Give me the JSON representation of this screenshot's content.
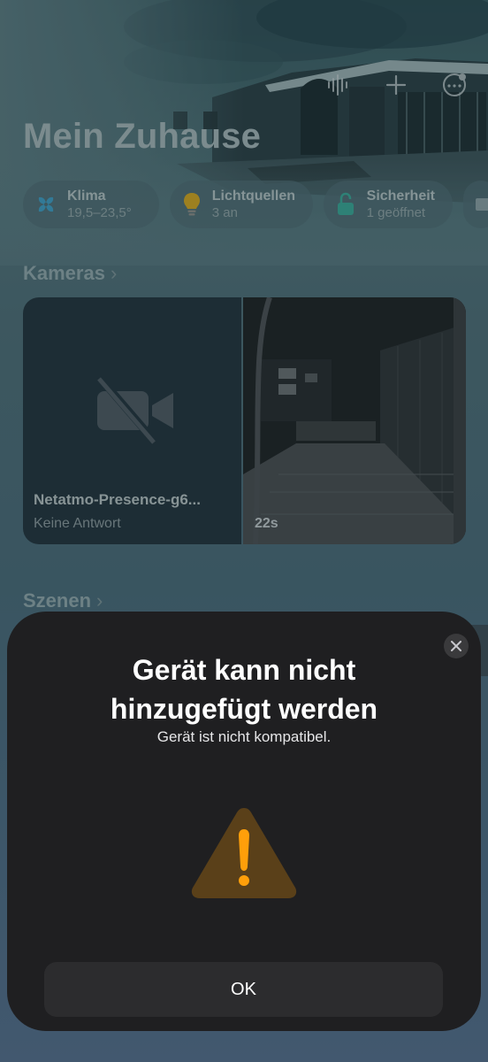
{
  "header": {
    "title": "Mein Zuhause",
    "icons": [
      "waveform-icon",
      "plus-icon",
      "more-icon"
    ]
  },
  "chips": [
    {
      "label": "Klima",
      "value": "19,5–23,5°",
      "icon": "fan-icon"
    },
    {
      "label": "Lichtquellen",
      "value": "3 an",
      "icon": "lightbulb-icon"
    },
    {
      "label": "Sicherheit",
      "value": "1 geöffnet",
      "icon": "lock-open-icon"
    }
  ],
  "sections": {
    "cameras": "Kameras",
    "scenes": "Szenen"
  },
  "cameras": [
    {
      "name": "Netatmo-Presence-g6...",
      "status": "Keine Antwort",
      "icon": "video-off-icon"
    },
    {
      "age": "22s"
    }
  ],
  "dialog": {
    "title": "Gerät kann nicht hinzugefügt werden",
    "message": "Gerät ist nicht kompatibel.",
    "icon": "warning-icon",
    "ok_label": "OK",
    "accent_color": "#ff9f0a"
  }
}
